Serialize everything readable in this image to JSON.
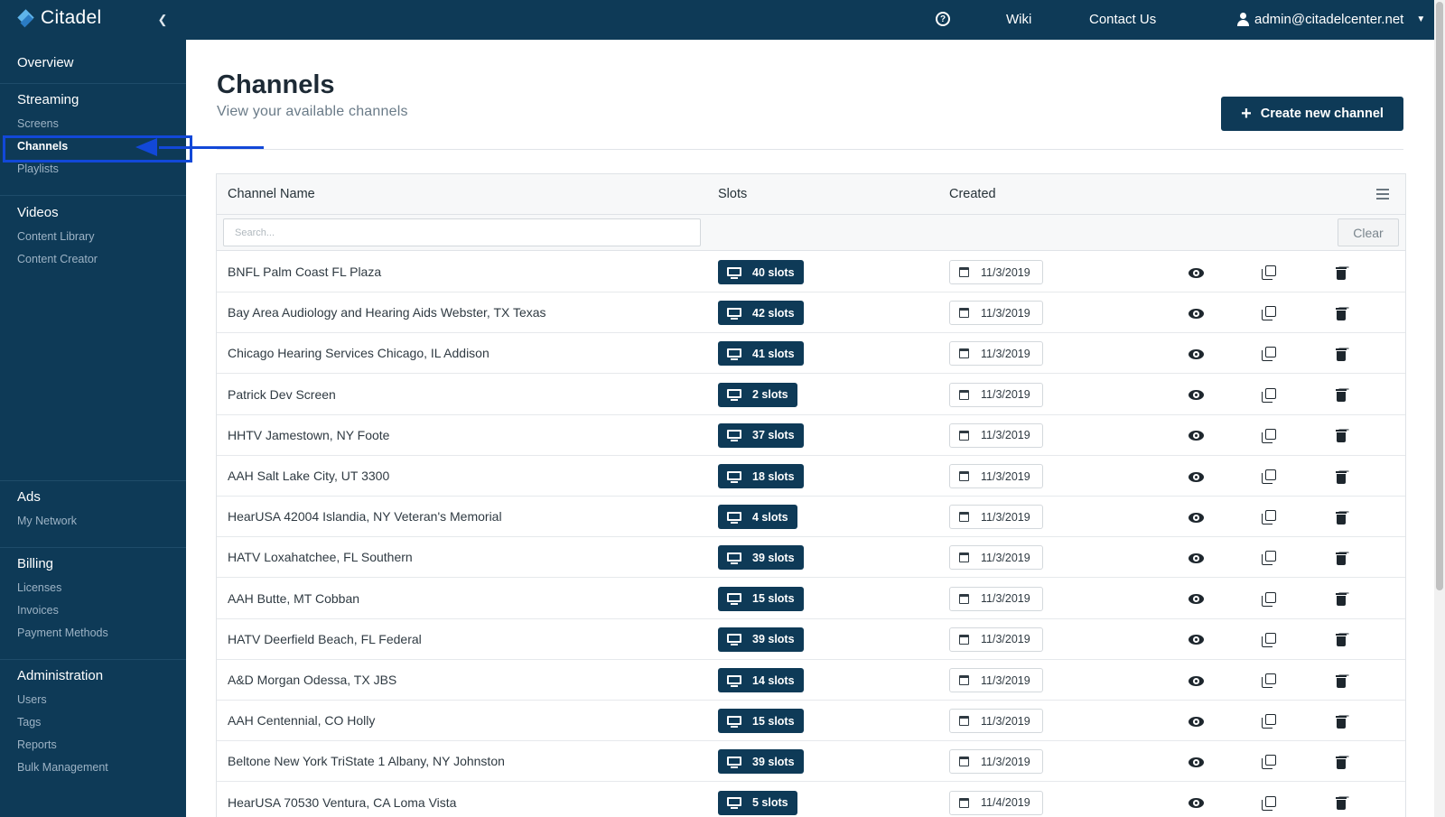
{
  "app": {
    "brand_name": "Citadel",
    "collapse_icon": "chevron-left-icon"
  },
  "topnav": {
    "help_icon": "question-circle-icon",
    "wiki_label": "Wiki",
    "contact_label": "Contact Us",
    "user_email": "admin@citadelcenter.net"
  },
  "sidebar": {
    "overview": "Overview",
    "streaming": {
      "heading": "Streaming",
      "screens": "Screens",
      "channels": "Channels",
      "playlists": "Playlists"
    },
    "videos": {
      "heading": "Videos",
      "content_library": "Content Library",
      "content_creator": "Content Creator"
    },
    "ads": {
      "heading": "Ads",
      "my_network": "My Network"
    },
    "billing": {
      "heading": "Billing",
      "licenses": "Licenses",
      "invoices": "Invoices",
      "payment_methods": "Payment Methods"
    },
    "administration": {
      "heading": "Administration",
      "users": "Users",
      "tags": "Tags",
      "reports": "Reports",
      "bulk_management": "Bulk Management"
    },
    "active_item": "Channels"
  },
  "page": {
    "title": "Channels",
    "subtitle": "View your available channels",
    "create_button": "Create new channel"
  },
  "table": {
    "columns": {
      "name": "Channel Name",
      "slots": "Slots",
      "created": "Created"
    },
    "search_placeholder": "Search...",
    "clear_label": "Clear",
    "rows": [
      {
        "name": "BNFL Palm Coast FL Plaza",
        "slots": "40 slots",
        "created": "11/3/2019"
      },
      {
        "name": "Bay Area Audiology and Hearing Aids Webster, TX Texas",
        "slots": "42 slots",
        "created": "11/3/2019"
      },
      {
        "name": "Chicago Hearing Services Chicago, IL Addison",
        "slots": "41 slots",
        "created": "11/3/2019"
      },
      {
        "name": "Patrick Dev Screen",
        "slots": "2 slots",
        "created": "11/3/2019"
      },
      {
        "name": "HHTV Jamestown, NY Foote",
        "slots": "37 slots",
        "created": "11/3/2019"
      },
      {
        "name": "AAH Salt Lake City, UT 3300",
        "slots": "18 slots",
        "created": "11/3/2019"
      },
      {
        "name": "HearUSA 42004 Islandia, NY Veteran's Memorial",
        "slots": "4 slots",
        "created": "11/3/2019"
      },
      {
        "name": "HATV Loxahatchee, FL Southern",
        "slots": "39 slots",
        "created": "11/3/2019"
      },
      {
        "name": "AAH Butte, MT Cobban",
        "slots": "15 slots",
        "created": "11/3/2019"
      },
      {
        "name": "HATV Deerfield Beach, FL Federal",
        "slots": "39 slots",
        "created": "11/3/2019"
      },
      {
        "name": "A&D Morgan Odessa, TX JBS",
        "slots": "14 slots",
        "created": "11/3/2019"
      },
      {
        "name": "AAH Centennial, CO Holly",
        "slots": "15 slots",
        "created": "11/3/2019"
      },
      {
        "name": "Beltone New York TriState 1 Albany, NY Johnston",
        "slots": "39 slots",
        "created": "11/3/2019"
      },
      {
        "name": "HearUSA 70530 Ventura, CA Loma Vista",
        "slots": "5 slots",
        "created": "11/4/2019"
      }
    ]
  },
  "colors": {
    "navy": "#0e3a57",
    "annotation_blue": "#1248d8",
    "sidebar_subtext": "#9db3c5"
  }
}
